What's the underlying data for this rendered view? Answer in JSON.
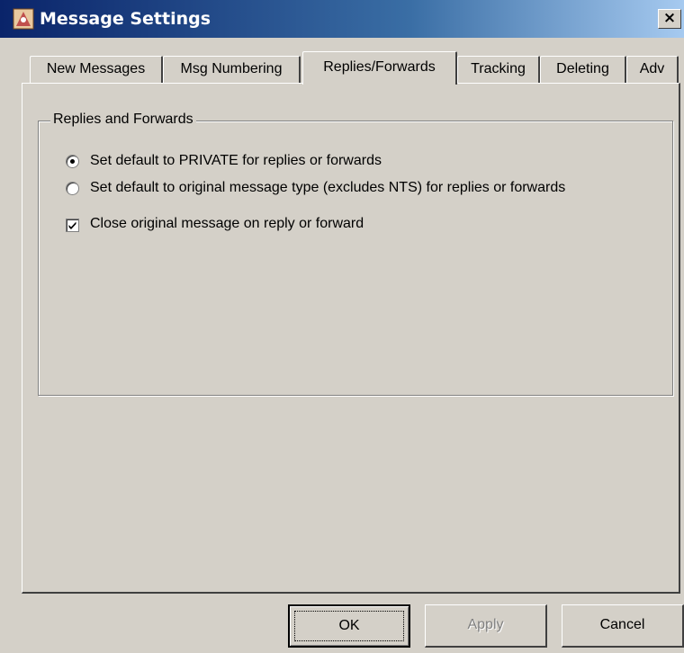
{
  "window": {
    "title": "Message Settings",
    "close_glyph": "×"
  },
  "tabs": [
    {
      "label": "New Messages"
    },
    {
      "label": "Msg Numbering"
    },
    {
      "label": "Replies/Forwards"
    },
    {
      "label": "Tracking"
    },
    {
      "label": "Deleting"
    },
    {
      "label": "Adv"
    }
  ],
  "active_tab": "Replies/Forwards",
  "group": {
    "label": "Replies and Forwards",
    "options": [
      {
        "label": "Set default to PRIVATE for replies or forwards",
        "selected": true
      },
      {
        "label": "Set default to original message type (excludes NTS) for replies or forwards",
        "selected": false
      }
    ],
    "close_original": {
      "label": "Close original message on reply or forward",
      "checked": true
    }
  },
  "buttons": {
    "ok": "OK",
    "apply": "Apply",
    "cancel": "Cancel"
  },
  "colors": {
    "face": "#d4d0c8",
    "title_start": "#0a246a",
    "title_end": "#a6caf0"
  }
}
